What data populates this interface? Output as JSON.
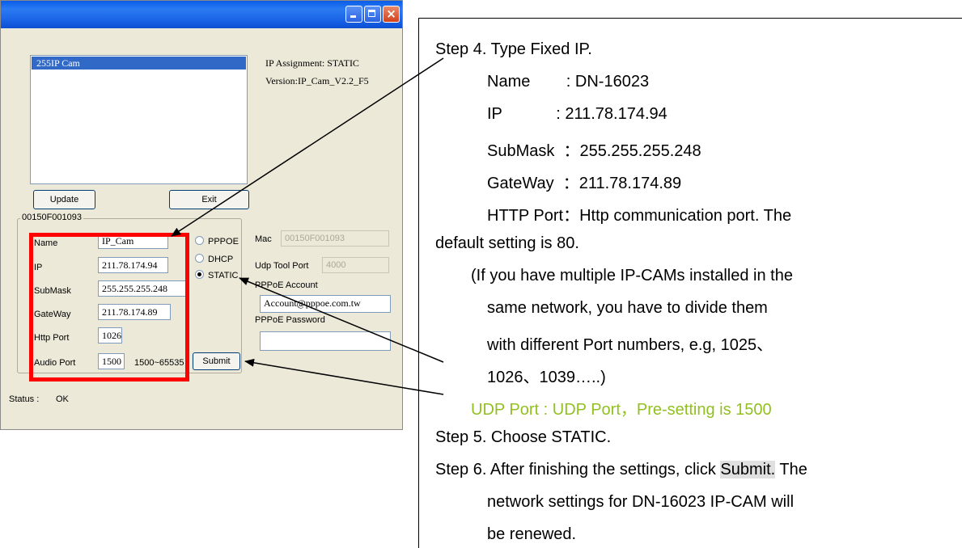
{
  "window": {
    "device_list": [
      "255IP Cam"
    ],
    "ip_assignment": "IP Assignment: STATIC",
    "version": "Version:IP_Cam_V2.2_F5",
    "update_button": "Update",
    "exit_button": "Exit",
    "group_title": "00150F001093",
    "fields": {
      "name_label": "Name",
      "name_value": "IP_Cam",
      "ip_label": "IP",
      "ip_value": "211.78.174.94",
      "submask_label": "SubMask",
      "submask_value": "255.255.255.248",
      "gateway_label": "GateWay",
      "gateway_value": "211.78.174.89",
      "http_label": "Http Port",
      "http_value": "1026",
      "audio_label": "Audio Port",
      "audio_value": "1500",
      "audio_range": "1500~65535"
    },
    "radios": {
      "pppoe": "PPPOE",
      "dhcp": "DHCP",
      "static": "STATIC",
      "selected": "STATIC"
    },
    "mac_label": "Mac",
    "mac_value": "00150F001093",
    "udp_label": "Udp Tool Port",
    "udp_value": "4000",
    "pppoe_account_label": "PPPoE Account",
    "pppoe_account_value": "Account@pppoe.com.tw",
    "pppoe_password_label": "PPPoE Password",
    "pppoe_password_value": "",
    "submit_button": "Submit",
    "status_label": "Status :",
    "status_value": "OK"
  },
  "instructions": {
    "step4": "Step 4. Type Fixed IP.",
    "name_line": "Name        : DN-16023",
    "ip_line": "IP            : 211.78.174.94",
    "submask_line": "SubMask  ：255.255.255.248",
    "gateway_line": "GateWay  ：211.78.174.89",
    "http_line": "HTTP Port：Http communication port. The",
    "http_line2": "default setting is 80.",
    "note_line1": "(If you have multiple IP-CAMs installed in the",
    "note_line2": "same network, you have to divide them",
    "note_line3": "with different Port numbers, e.g, 1025、",
    "note_line4": "1026、1039…..)",
    "udp_line": "UDP Port : UDP Port，Pre-setting is 1500",
    "step5": "Step 5. Choose STATIC.",
    "step6_pre": "Step 6. After finishing the settings, click ",
    "step6_submit": "Submit.",
    "step6_post": " The",
    "step6_line2": "network settings for DN-16023 IP-CAM will",
    "step6_line3": "be renewed."
  },
  "colors": {
    "highlight_box": "#ff0000",
    "udp_note": "#92c020",
    "titlebar": "#1a64e6"
  }
}
